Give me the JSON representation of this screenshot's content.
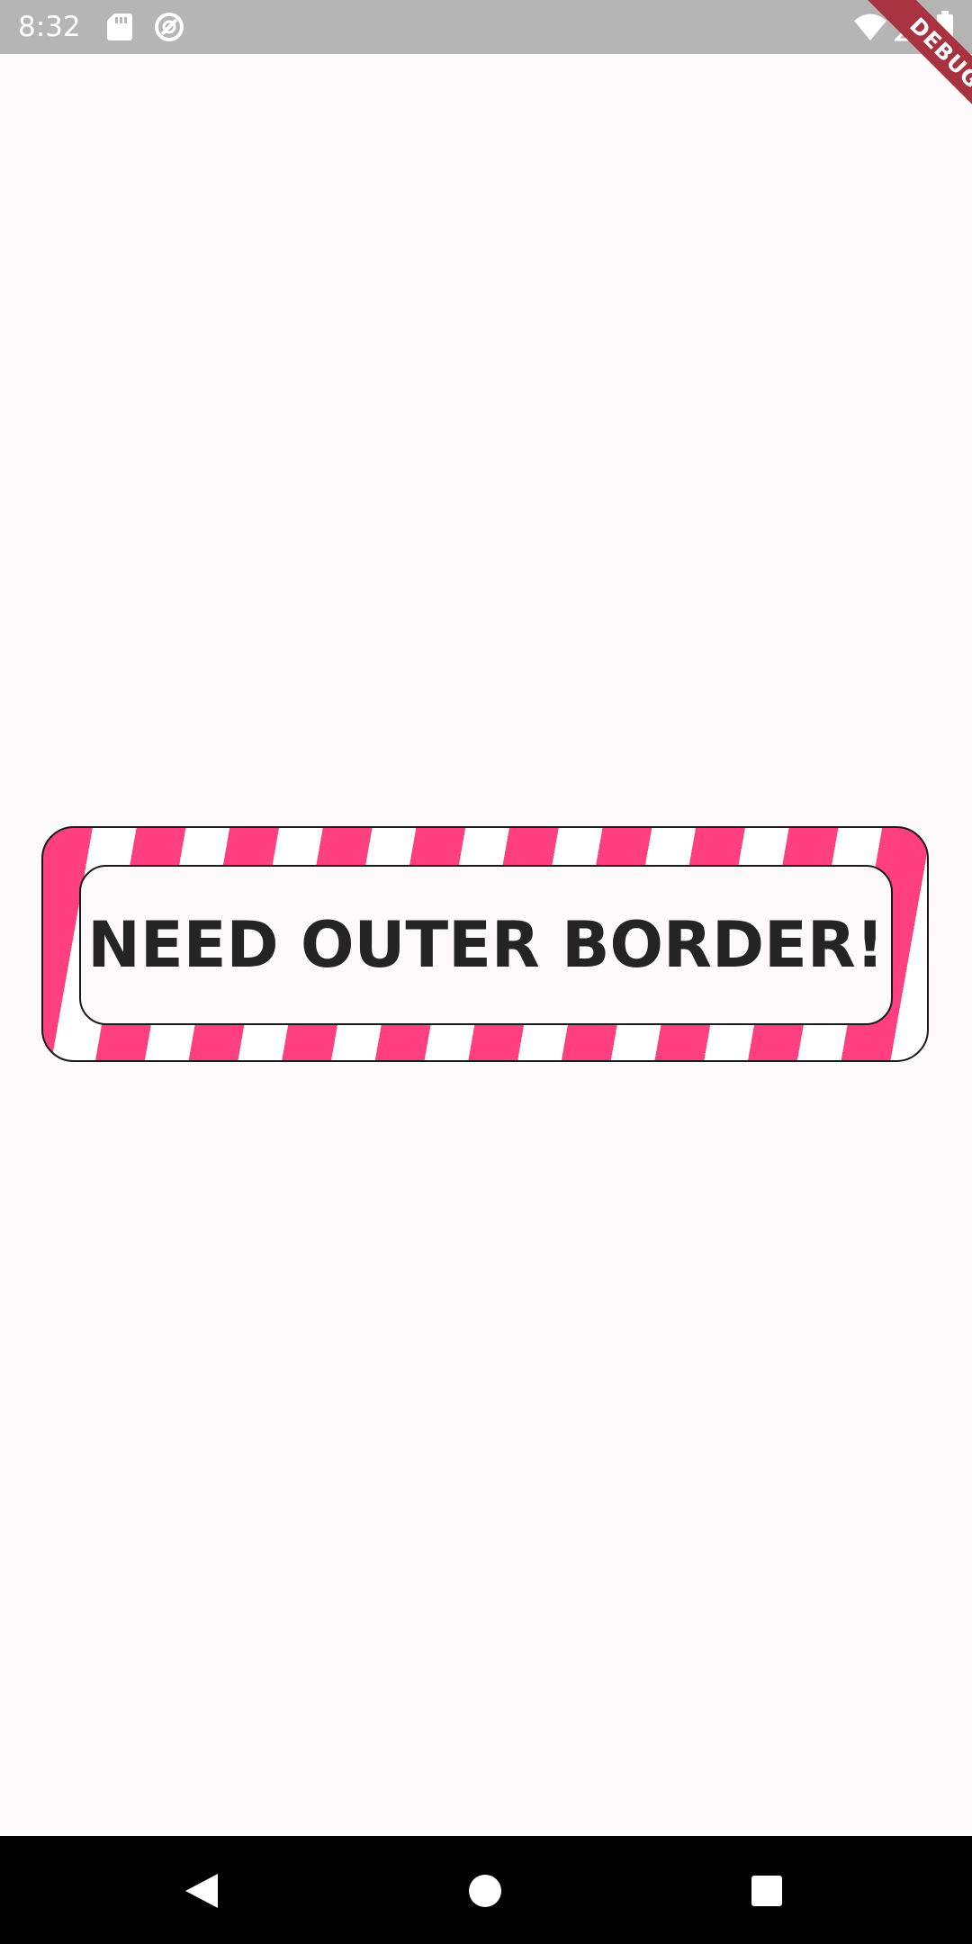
{
  "status_bar": {
    "time": "8:32",
    "icons": [
      "sd-card-icon",
      "sync-icon",
      "wifi-icon",
      "signal-icon",
      "battery-icon"
    ]
  },
  "debug_banner": {
    "label": "DEBUG",
    "color": "#a8323f"
  },
  "card": {
    "title": "NEED OUTER BORDER!",
    "stripe_colors": [
      "#ff3f7f",
      "#ffffff"
    ],
    "text_color": "#242424",
    "background": "#fcfafb"
  },
  "nav_bar": {
    "buttons": [
      "back-icon",
      "home-icon",
      "recents-icon"
    ]
  }
}
